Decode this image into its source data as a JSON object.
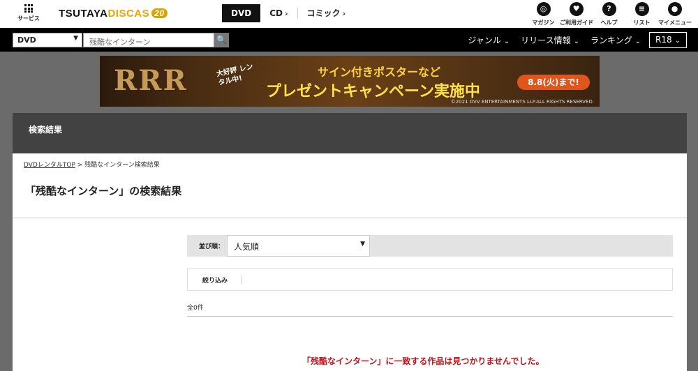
{
  "header": {
    "service_label": "サービス",
    "logo": {
      "main": "TSUTAYA",
      "sub": "DISCAS",
      "badge": "20"
    },
    "tabs": [
      {
        "label": "DVD"
      },
      {
        "label": "CD"
      },
      {
        "label": "コミック"
      }
    ],
    "icons": [
      {
        "label": "マガジン",
        "glyph": "◎"
      },
      {
        "label": "ご利用ガイド",
        "glyph": "♥"
      },
      {
        "label": "ヘルプ",
        "glyph": "?"
      },
      {
        "label": "リスト",
        "glyph": "≡"
      },
      {
        "label": "マイメニュー",
        "glyph": "●"
      }
    ]
  },
  "search": {
    "category": "DVD",
    "query": "残酷なインターン",
    "button_glyph": "🔍"
  },
  "nav": {
    "items": [
      {
        "label": "ジャンル"
      },
      {
        "label": "リリース情報"
      },
      {
        "label": "ランキング"
      }
    ],
    "r18": "R18"
  },
  "banner": {
    "logo_text": "RRR",
    "tag": "大好評 レンタル中!",
    "line1": "サイン付きポスターなど",
    "line2": "プレゼントキャンペーン実施中",
    "date": "8.8(火)まで!",
    "copyright": "©2021 DVV ENTERTAINMENTS LLP.ALL RIGHTS RESERVED."
  },
  "main": {
    "section_title": "検索結果",
    "breadcrumb": {
      "home": "DVDレンタルTOP",
      "sep": " > ",
      "current": "残酷なインターン検索結果"
    },
    "heading": "「残酷なインターン」の検索結果",
    "sort_label": "並び順：",
    "sort_value": "人気順",
    "filter_label": "絞り込み",
    "count": "全0件",
    "no_results": "「残酷なインターン」に一致する作品は見つかりませんでした。"
  },
  "colors": {
    "accent_red": "#c0141b",
    "dark_bar": "#000000",
    "section_head": "#424242"
  }
}
